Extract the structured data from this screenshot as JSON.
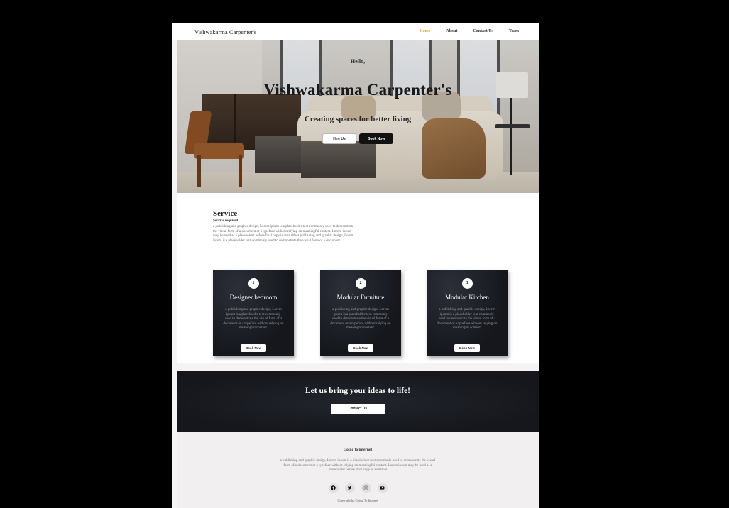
{
  "nav": {
    "brand": "Vishwakarma Carpenter's",
    "links": [
      "Home",
      "About",
      "Contact Us",
      "Team"
    ],
    "active": "Home",
    "accent_color": "#e0a12b"
  },
  "hero": {
    "greeting": "Hello,",
    "title": "Vishwakarma Carpenter's",
    "tagline": "Creating spaces for better living",
    "buttons": [
      "Hire Us",
      "Book Now"
    ]
  },
  "service": {
    "title": "Service",
    "subtitle": "Service required",
    "text": "a publishing and graphic design, Lorem ipsum is a placeholder text commonly used to demonstrate the visual form of a document or a typeface without relying on meaningful content. Lorem ipsum may be used as a placeholder before final copy is available.a publishing and graphic design, Lorem ipsum is a placeholder text commonly used to demonstrate the visual form of a document"
  },
  "cards": [
    {
      "num": "1",
      "title": "Designer bedroom",
      "text": "a publishing and graphic design, Lorem ipsum is a placeholder text commonly used to demonstrate the visual form of a document or a typeface without relying on meaningful content.",
      "button": "Book Now"
    },
    {
      "num": "2",
      "title": "Modular Furniture",
      "text": "a publishing and graphic design, Lorem ipsum is a placeholder text commonly used to demonstrate the visual form of a document or a typeface without relying on meaningful content.",
      "button": "Book Now"
    },
    {
      "num": "3",
      "title": "Modular Kitchen",
      "text": "a publishing and graphic design, Lorem ipsum is a placeholder text commonly used to demonstrate the visual form of a document or a typeface without relying on meaningful content.",
      "button": "Book Now"
    }
  ],
  "cta": {
    "title": "Let us bring your ideas to life!",
    "button": "Contact Us"
  },
  "footer": {
    "title": "Going to internet",
    "text": "a publishing and graphic design, Lorem ipsum is a placeholder text commonly used to demonstrate the visual form of a document or a typeface without relying on meaningful content. Lorem ipsum may be used as a placeholder before final copy is available",
    "socials": [
      "facebook-icon",
      "twitter-icon",
      "instagram-icon",
      "youtube-icon"
    ],
    "copyright": "Copyright by Going To Internet"
  }
}
